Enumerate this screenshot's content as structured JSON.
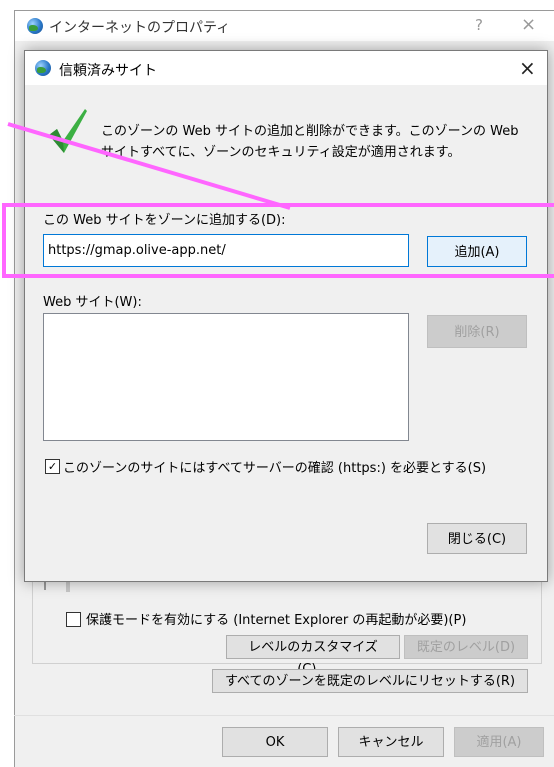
{
  "background_window": {
    "title": "インターネットのプロパティ",
    "help": "?",
    "close": "×",
    "protected_mode_label": "保護モードを有効にする (Internet Explorer の再起動が必要)(P)",
    "customize_level_label": "レベルのカスタマイズ(C)...",
    "default_level_label": "既定のレベル(D)",
    "reset_all_label": "すべてのゾーンを既定のレベルにリセットする(R)",
    "ok_label": "OK",
    "cancel_label": "キャンセル",
    "apply_label": "適用(A)"
  },
  "dialog": {
    "title": "信頼済みサイト",
    "close": "×",
    "info_text": "このゾーンの Web サイトの追加と削除ができます。このゾーンの Web サイトすべてに、ゾーンのセキュリティ設定が適用されます。",
    "add_label": "この Web サイトをゾーンに追加する(D):",
    "url_value": "https://gmap.olive-app.net/",
    "add_button": "追加(A)",
    "sites_label": "Web サイト(W):",
    "sites": [],
    "remove_button": "削除(R)",
    "https_checkbox_label": "このゾーンのサイトにはすべてサーバーの確認 (https:) を必要とする(S)",
    "https_checked": true,
    "close_button": "閉じる(C)"
  },
  "colors": {
    "annotation": "#ff66ff",
    "focus": "#0078d7",
    "check_green": "#3cb043"
  }
}
